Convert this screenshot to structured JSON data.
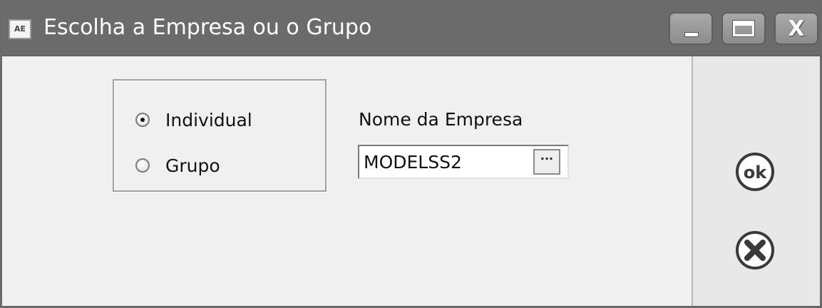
{
  "window": {
    "title": "Escolha a Empresa ou o Grupo",
    "icon_text": "AE",
    "controls": {
      "minimize_icon": "minimize-icon",
      "maximize_icon": "maximize-icon",
      "close_icon": "close-icon",
      "close_glyph": "X"
    }
  },
  "selection": {
    "options": [
      {
        "label": "Individual",
        "checked": true
      },
      {
        "label": "Grupo",
        "checked": false
      }
    ]
  },
  "company": {
    "label": "Nome da Empresa",
    "value": "MODELSS2",
    "browse_label": "···"
  },
  "actions": {
    "ok_label": "ok",
    "cancel_icon": "cancel-x-icon"
  },
  "colors": {
    "titlebar": "#6b6b6b",
    "background": "#f0f0f0"
  }
}
